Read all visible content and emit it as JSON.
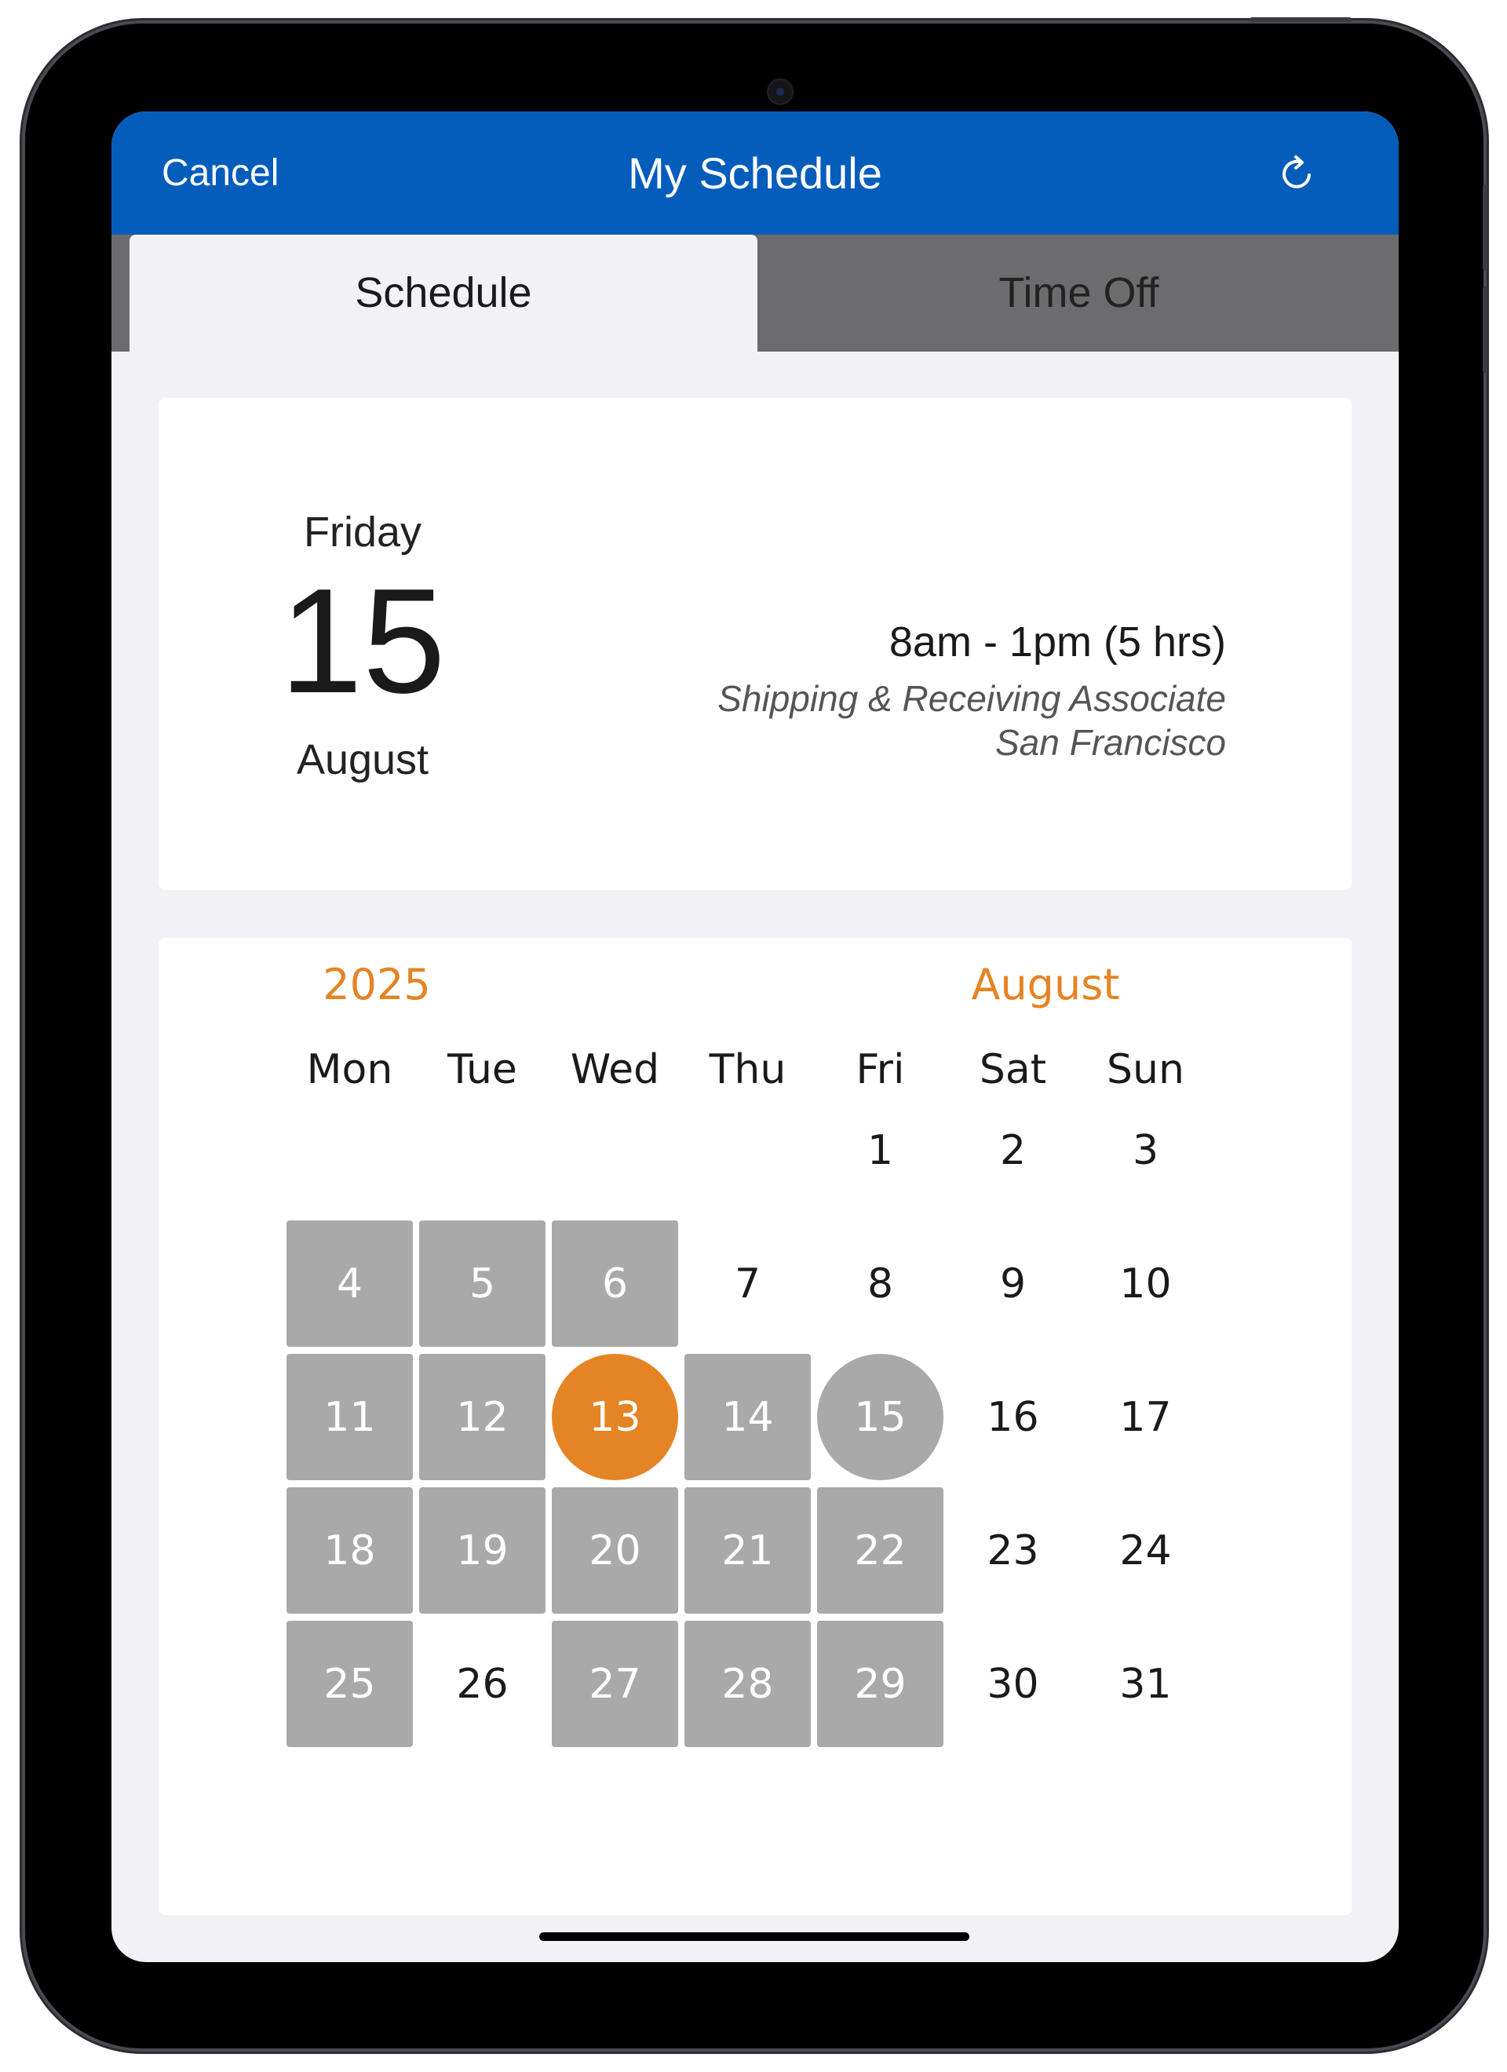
{
  "navbar": {
    "cancel_label": "Cancel",
    "title": "My Schedule",
    "refresh_icon": "refresh-icon",
    "background_color": "#055dbb"
  },
  "tabs": [
    {
      "label": "Schedule",
      "selected": true
    },
    {
      "label": "Time Off",
      "selected": false
    }
  ],
  "shift_detail": {
    "weekday": "Friday",
    "day": "15",
    "month": "August",
    "time": "8am - 1pm (5 hrs)",
    "role": "Shipping & Receiving Associate",
    "location": "San Francisco"
  },
  "calendar": {
    "year": "2025",
    "month": "August",
    "accent_color": "#e58424",
    "weekdays": [
      "Mon",
      "Tue",
      "Wed",
      "Thu",
      "Fri",
      "Sat",
      "Sun"
    ],
    "weeks": [
      [
        null,
        null,
        null,
        null,
        {
          "d": "1"
        },
        {
          "d": "2"
        },
        {
          "d": "3"
        }
      ],
      [
        {
          "d": "4",
          "s": "scheduled"
        },
        {
          "d": "5",
          "s": "scheduled"
        },
        {
          "d": "6",
          "s": "scheduled"
        },
        {
          "d": "7"
        },
        {
          "d": "8"
        },
        {
          "d": "9"
        },
        {
          "d": "10"
        }
      ],
      [
        {
          "d": "11",
          "s": "scheduled"
        },
        {
          "d": "12",
          "s": "scheduled"
        },
        {
          "d": "13",
          "s": "today"
        },
        {
          "d": "14",
          "s": "scheduled"
        },
        {
          "d": "15",
          "s": "selected"
        },
        {
          "d": "16"
        },
        {
          "d": "17"
        }
      ],
      [
        {
          "d": "18",
          "s": "scheduled"
        },
        {
          "d": "19",
          "s": "scheduled"
        },
        {
          "d": "20",
          "s": "scheduled"
        },
        {
          "d": "21",
          "s": "scheduled"
        },
        {
          "d": "22",
          "s": "scheduled"
        },
        {
          "d": "23"
        },
        {
          "d": "24"
        }
      ],
      [
        {
          "d": "25",
          "s": "scheduled"
        },
        {
          "d": "26"
        },
        {
          "d": "27",
          "s": "scheduled"
        },
        {
          "d": "28",
          "s": "scheduled"
        },
        {
          "d": "29",
          "s": "scheduled"
        },
        {
          "d": "30"
        },
        {
          "d": "31"
        }
      ]
    ]
  }
}
